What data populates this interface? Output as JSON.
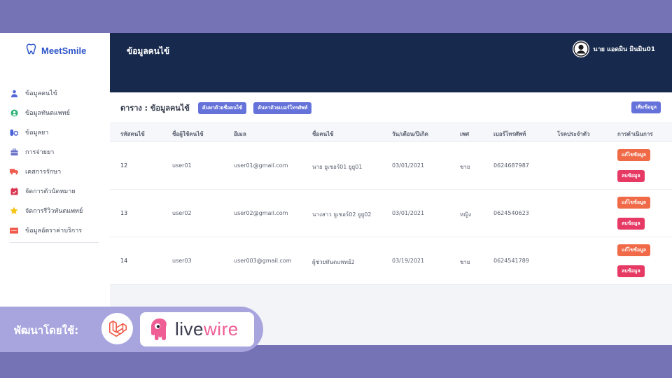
{
  "app": {
    "logo_text": "MeetSmile"
  },
  "sidebar": {
    "items": [
      {
        "label": "ข้อมูลคนไข้",
        "icon": "user-icon",
        "color": "#5468d8"
      },
      {
        "label": "ข้อมูลทันตแพทย์",
        "icon": "doctor-icon",
        "color": "#2fb37a"
      },
      {
        "label": "ข้อมูลยา",
        "icon": "pills-icon",
        "color": "#4a63d9"
      },
      {
        "label": "การจ่ายยา",
        "icon": "briefcase-icon",
        "color": "#6a72c8"
      },
      {
        "label": "เคสการรักษา",
        "icon": "truck-icon",
        "color": "#ef5a4d"
      },
      {
        "label": "จัดการตัวนัดหมาย",
        "icon": "calendar-icon",
        "color": "#d9334f"
      },
      {
        "label": "จัดการรีวิวทันตแพทย์",
        "icon": "star-icon",
        "color": "#f5c418"
      },
      {
        "label": "ข้อมูลอัตราค่าบริการ",
        "icon": "price-tag-icon",
        "color": "#ef5a4d"
      }
    ]
  },
  "header": {
    "title": "ข้อมูลคนไข้",
    "user_name": "นาย แอดมิน มินมิน01"
  },
  "table": {
    "title": "ตาราง : ข้อมูลคนไข้",
    "search_by_name_label": "ค้นหาด้วยชื่อคนไข้",
    "search_by_phone_label": "ค้นหาด้วยเบอร์โทรศัพท์",
    "add_label": "เพิ่มข้อมูล",
    "edit_label": "แก้ไขข้อมูล",
    "delete_label": "ลบข้อมูล",
    "columns": [
      "รหัสคนไข้",
      "ชื่อผู้ใช้คนไข้",
      "อีเมล",
      "ชื่อคนไข้",
      "วัน/เดือน/ปีเกิด",
      "เพศ",
      "เบอร์โทรศัพท์",
      "โรคประจำตัว",
      "การดำเนินการ"
    ],
    "rows": [
      {
        "id": "12",
        "username": "user01",
        "email": "user01@gmail.com",
        "name": "นาย ยูเซอร์01 ยูยู01",
        "dob": "03/01/2021",
        "gender": "ชาย",
        "phone": "0624687987",
        "disease": ""
      },
      {
        "id": "13",
        "username": "user02",
        "email": "user02@gmail.com",
        "name": "นางสาว ยูเซอร์02 ยูยู02",
        "dob": "03/01/2021",
        "gender": "หญิง",
        "phone": "0624540623",
        "disease": ""
      },
      {
        "id": "14",
        "username": "user03",
        "email": "user003@gmail.com",
        "name": "ผู้ช่วยทันตแพทย์2",
        "dob": "03/19/2021",
        "gender": "ชาย",
        "phone": "0624541789",
        "disease": ""
      }
    ]
  },
  "banner": {
    "text": "พัฒนาโดยใช้:",
    "livewire_text_a": "live",
    "livewire_text_b": "wire"
  },
  "colors": {
    "navy": "#172a4d",
    "indigo": "#6572d9",
    "edit": "#f06a48",
    "delete": "#e63a65",
    "frame": "#7572b6"
  }
}
